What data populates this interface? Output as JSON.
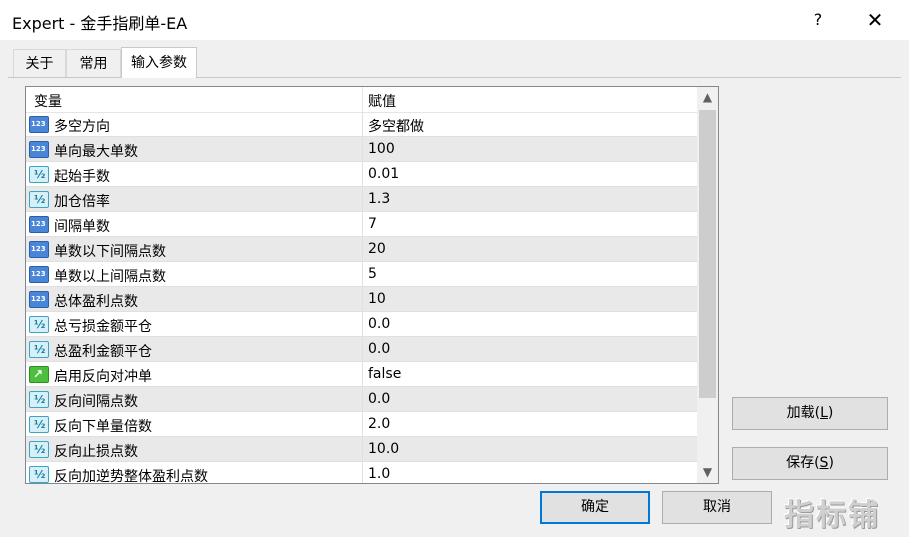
{
  "window": {
    "title": "Expert - 金手指刷单-EA",
    "help": "?",
    "close": "✕"
  },
  "tabs": [
    {
      "label": "关于"
    },
    {
      "label": "常用"
    },
    {
      "label": "输入参数"
    }
  ],
  "grid": {
    "header": {
      "variable": "变量",
      "value": "赋值"
    },
    "rows": [
      {
        "type": "int",
        "name": "多空方向",
        "value": "多空都做"
      },
      {
        "type": "int",
        "name": "单向最大单数",
        "value": "100"
      },
      {
        "type": "double",
        "name": "起始手数",
        "value": "0.01"
      },
      {
        "type": "double",
        "name": "加仓倍率",
        "value": "1.3"
      },
      {
        "type": "int",
        "name": "间隔单数",
        "value": "7"
      },
      {
        "type": "int",
        "name": "单数以下间隔点数",
        "value": "20"
      },
      {
        "type": "int",
        "name": "单数以上间隔点数",
        "value": "5"
      },
      {
        "type": "int",
        "name": "总体盈利点数",
        "value": "10"
      },
      {
        "type": "double",
        "name": "总亏损金额平仓",
        "value": "0.0"
      },
      {
        "type": "double",
        "name": "总盈利金额平仓",
        "value": "0.0"
      },
      {
        "type": "bool",
        "name": "启用反向对冲单",
        "value": "false"
      },
      {
        "type": "double",
        "name": "反向间隔点数",
        "value": "0.0"
      },
      {
        "type": "double",
        "name": "反向下单量倍数",
        "value": "2.0"
      },
      {
        "type": "double",
        "name": "反向止损点数",
        "value": "10.0"
      },
      {
        "type": "double",
        "name": "反向加逆势整体盈利点数",
        "value": "1.0"
      }
    ],
    "scroll": {
      "up": "▲",
      "down": "▼"
    }
  },
  "buttons": {
    "load": {
      "label": "加载(",
      "key": "L",
      "suffix": ")"
    },
    "save": {
      "label": "保存(",
      "key": "S",
      "suffix": ")"
    },
    "ok": "确定",
    "cancel": "取消"
  },
  "watermark": "指标铺"
}
